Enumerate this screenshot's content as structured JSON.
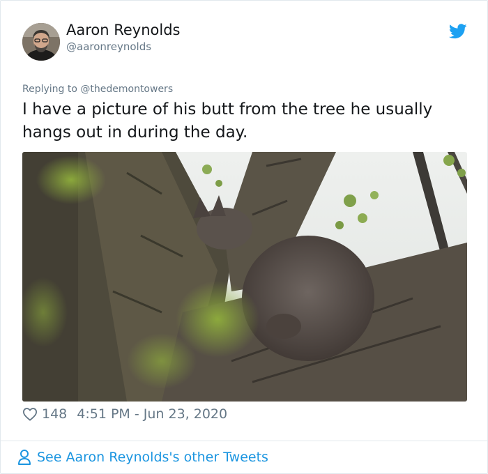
{
  "tweet": {
    "author_name": "Aaron Reynolds",
    "author_handle": "@aaronreynolds",
    "reply_prefix": "Replying to",
    "reply_to": "@thedemontowers",
    "text": "I have a picture of his butt from the tree he usually hangs out in during the day.",
    "likes": "148",
    "timestamp": "4:51 PM - Jun 23, 2020"
  },
  "footer": {
    "more_tweets": "See Aaron Reynolds's other Tweets"
  },
  "colors": {
    "twitter_blue": "#1da1f2",
    "link_blue": "#1b95e0",
    "muted": "#657786"
  }
}
